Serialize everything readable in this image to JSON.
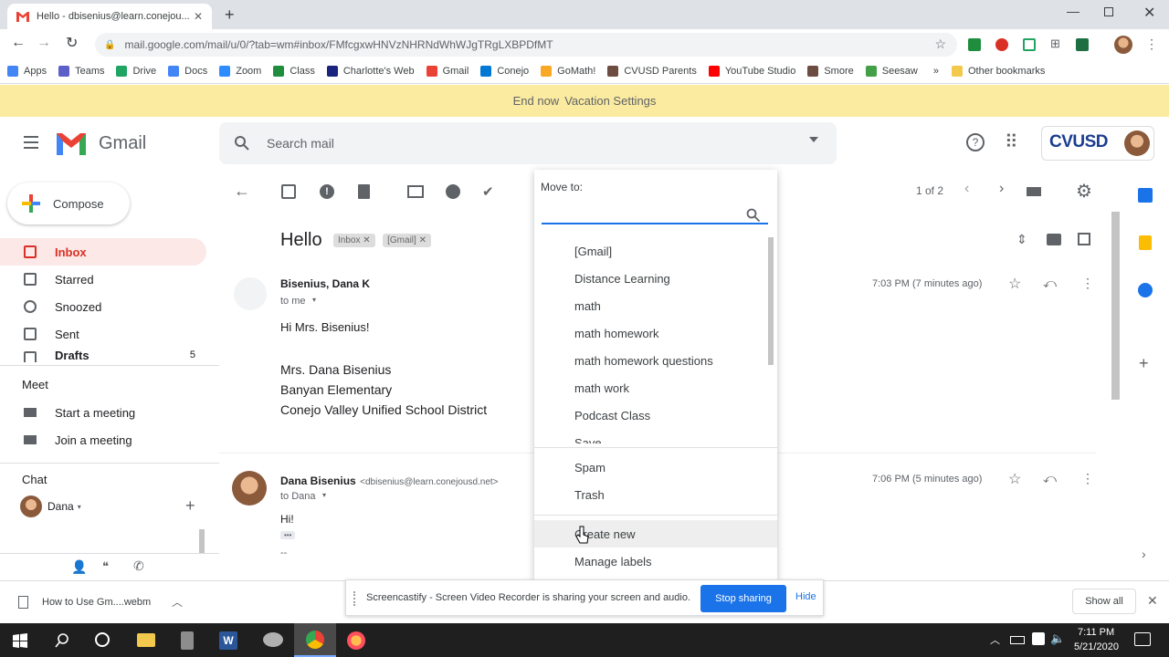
{
  "browser": {
    "tab_title": "Hello - dbisenius@learn.conejou...",
    "url": "mail.google.com/mail/u/0/?tab=wm#inbox/FMfcgxwHNVzNHRNdWhWJgTRgLXBPDfMT",
    "bookmarks": [
      {
        "label": "Apps",
        "color": "#4285f4"
      },
      {
        "label": "Teams",
        "color": "#5b5fc7"
      },
      {
        "label": "Drive",
        "color": "#1fa463"
      },
      {
        "label": "Docs",
        "color": "#4285f4"
      },
      {
        "label": "Zoom",
        "color": "#2d8cff"
      },
      {
        "label": "Class",
        "color": "#1e8e3e"
      },
      {
        "label": "Charlotte's Web",
        "color": "#1a237e"
      },
      {
        "label": "Gmail",
        "color": "#ea4335"
      },
      {
        "label": "Conejo",
        "color": "#0078d4"
      },
      {
        "label": "GoMath!",
        "color": "#f9a825"
      },
      {
        "label": "CVUSD Parents",
        "color": "#6d4c41"
      },
      {
        "label": "YouTube Studio",
        "color": "#ff0000"
      },
      {
        "label": "Smore",
        "color": "#6d4c41"
      },
      {
        "label": "Seesaw",
        "color": "#43a047"
      }
    ],
    "bookmarks_overflow": "»",
    "other_bookmarks": "Other bookmarks"
  },
  "vacation": {
    "end_now": "End now",
    "settings": "Vacation Settings"
  },
  "gmail": {
    "logo_text": "Gmail",
    "search_placeholder": "Search mail",
    "org_logo": "CVUSD"
  },
  "sidebar": {
    "compose": "Compose",
    "items": [
      {
        "label": "Inbox",
        "icon": "inbox-icon"
      },
      {
        "label": "Starred",
        "icon": "star-icon"
      },
      {
        "label": "Snoozed",
        "icon": "clock-icon"
      },
      {
        "label": "Sent",
        "icon": "send-icon"
      },
      {
        "label": "Drafts",
        "icon": "draft-icon",
        "count": "5"
      }
    ],
    "meet_heading": "Meet",
    "meet_items": [
      {
        "label": "Start a meeting",
        "icon": "video-icon"
      },
      {
        "label": "Join a meeting",
        "icon": "keyboard-icon"
      }
    ],
    "chat_heading": "Chat",
    "chat_user": "Dana"
  },
  "message": {
    "subject": "Hello",
    "labels": [
      "Inbox",
      "[Gmail]"
    ],
    "pagination": "1 of 2",
    "first": {
      "sender": "Bisenius, Dana K",
      "to": "to me",
      "time": "7:03 PM (7 minutes ago)",
      "greeting": "Hi Mrs. Bisenius!",
      "signature": [
        "Mrs. Dana Bisenius",
        "Banyan Elementary",
        "Conejo Valley Unified School District"
      ]
    },
    "second": {
      "sender": "Dana Bisenius",
      "email": "<dbisenius@learn.conejousd.net>",
      "to": "to Dana",
      "time": "7:06 PM (5 minutes ago)",
      "body": "Hi!",
      "ellipsis": "•••",
      "dash": "--"
    }
  },
  "move_to": {
    "heading": "Move to:",
    "labels": [
      "[Gmail]",
      "Distance Learning",
      "math",
      "math homework",
      "math homework questions",
      "math work",
      "Podcast Class",
      "Save"
    ],
    "system": [
      "Spam",
      "Trash"
    ],
    "actions": [
      "Create new",
      "Manage labels"
    ]
  },
  "download": {
    "file": "How to Use Gm....webm",
    "show_all": "Show all"
  },
  "screencastify": {
    "message": "Screencastify - Screen Video Recorder is sharing your screen and audio.",
    "stop": "Stop sharing",
    "hide": "Hide"
  },
  "taskbar": {
    "time": "7:11 PM",
    "date": "5/21/2020"
  },
  "colors": {
    "accent_red": "#d93025",
    "inbox_bg": "#fce8e6",
    "blue": "#1a73e8",
    "vacation_bg": "#fbeba0"
  }
}
